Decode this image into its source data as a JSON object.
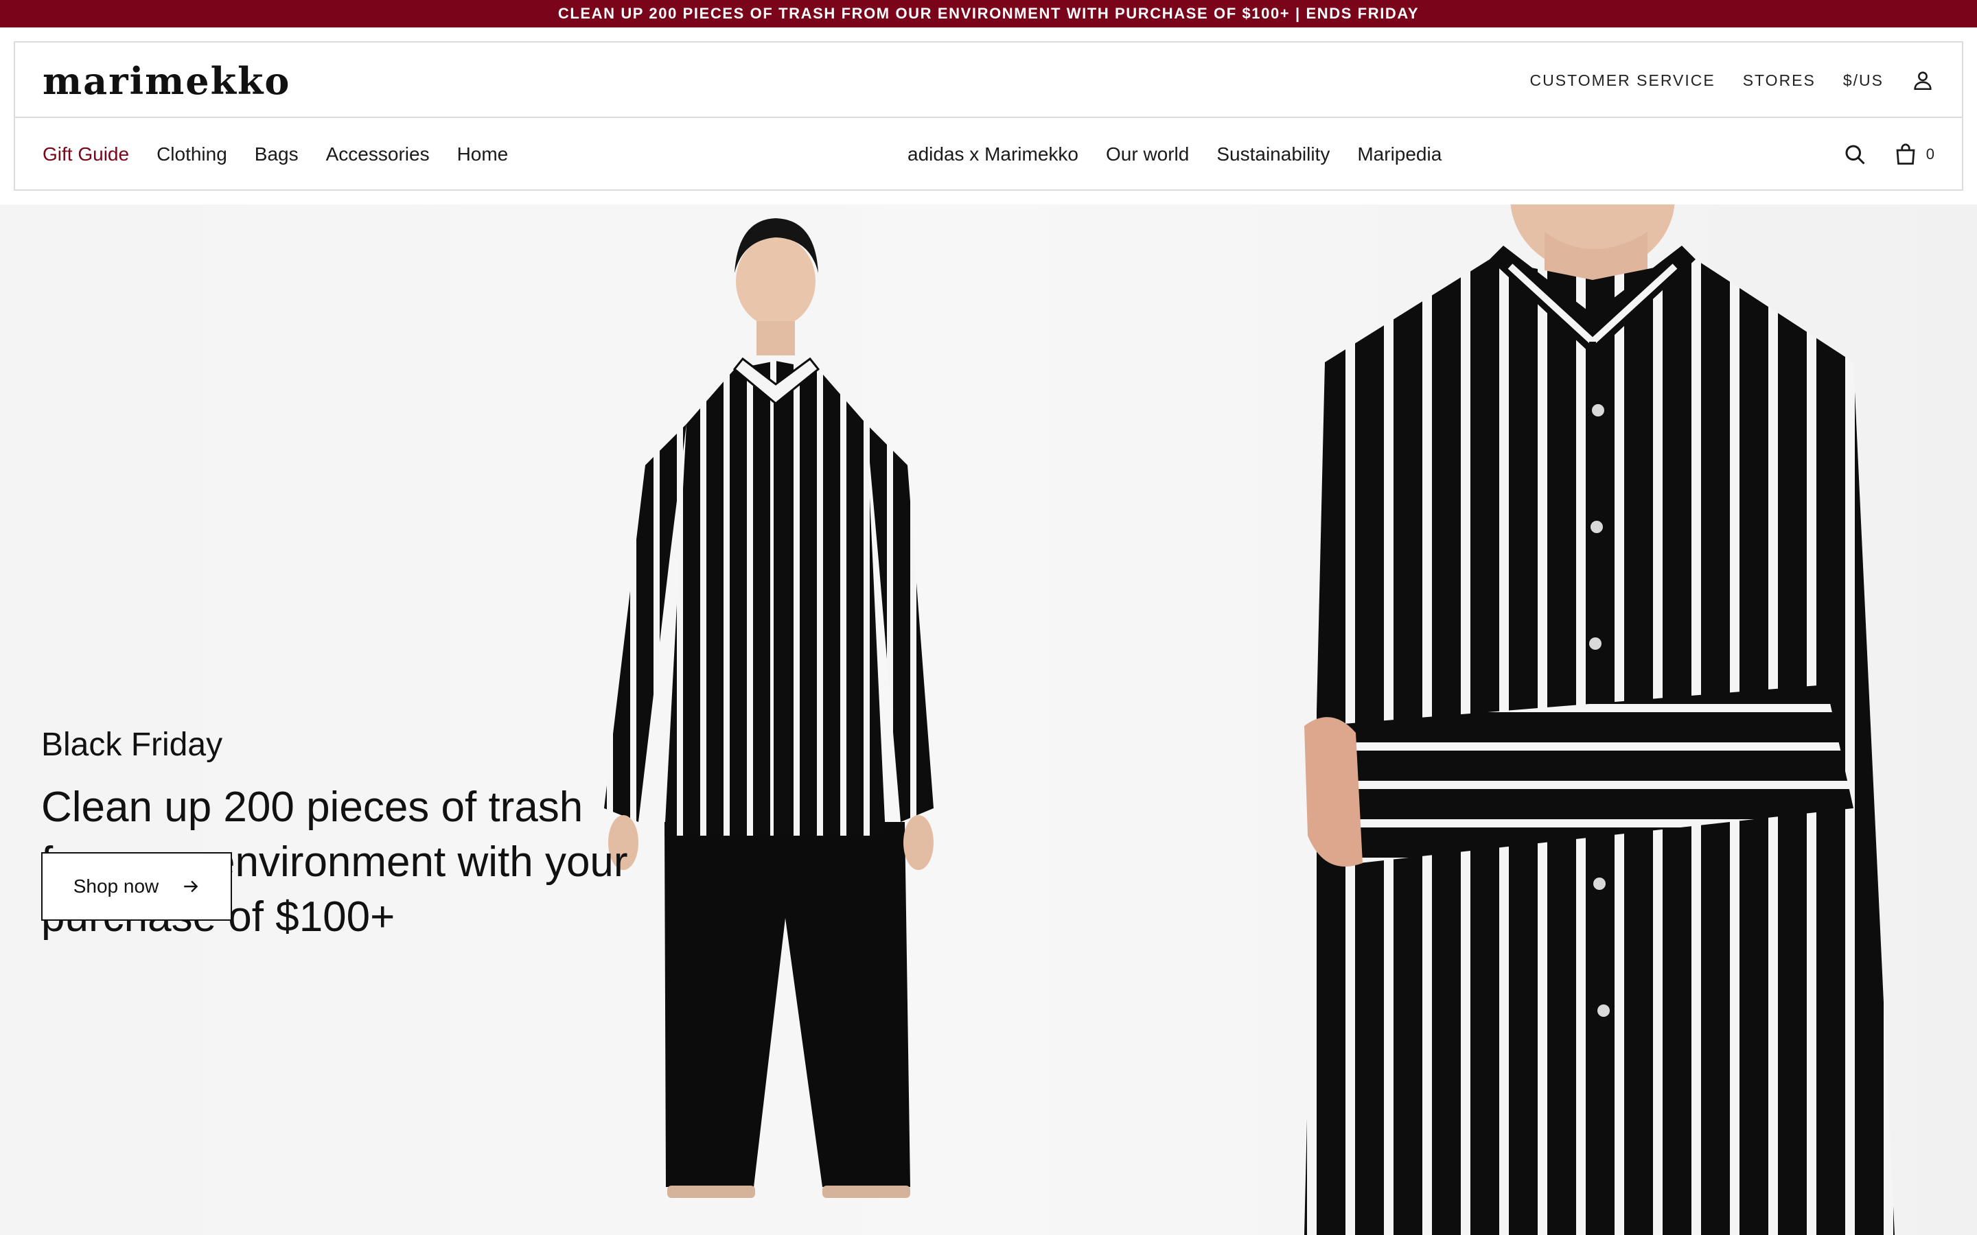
{
  "promo": {
    "text": "CLEAN UP 200 PIECES OF TRASH FROM OUR ENVIRONMENT WITH PURCHASE OF $100+ | ENDS FRIDAY"
  },
  "brand": {
    "logo": "marimekko",
    "accent_color": "#7a0419"
  },
  "utility_nav": {
    "customer_service": "CUSTOMER SERVICE",
    "stores": "STORES",
    "currency": "$/US",
    "account_icon": "user-icon"
  },
  "main_nav": {
    "left": [
      "Gift Guide",
      "Clothing",
      "Bags",
      "Accessories",
      "Home"
    ],
    "center": [
      "adidas x Marimekko",
      "Our world",
      "Sustainability",
      "Maripedia"
    ],
    "active": "Gift Guide"
  },
  "header_actions": {
    "search_icon": "search-icon",
    "bag_icon": "bag-icon",
    "bag_count": "0"
  },
  "hero": {
    "eyebrow": "Black Friday",
    "headline": "Clean up 200 pieces of trash from our environment with your purchase of $100+",
    "cta_label": "Shop now",
    "cta_icon": "arrow-right-icon"
  }
}
